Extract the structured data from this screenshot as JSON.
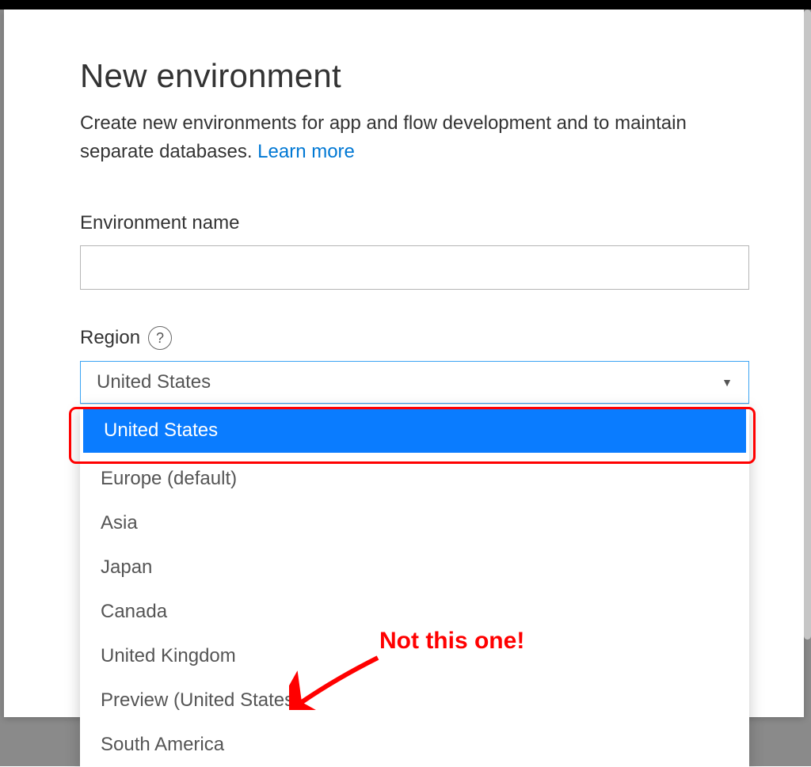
{
  "dialog": {
    "title": "New environment",
    "subtitle_pre": "Create new environments for app and flow development and to maintain separate databases. ",
    "learn_more": "Learn more"
  },
  "fields": {
    "env_name_label": "Environment name",
    "env_name_value": "",
    "region_label": "Region",
    "help_glyph": "?"
  },
  "region_select": {
    "selected": "United States",
    "options": [
      "United States",
      "Europe (default)",
      "Asia",
      "Japan",
      "Canada",
      "United Kingdom",
      "Preview (United States)",
      "South America"
    ]
  },
  "annotation": {
    "text": "Not this one!"
  }
}
